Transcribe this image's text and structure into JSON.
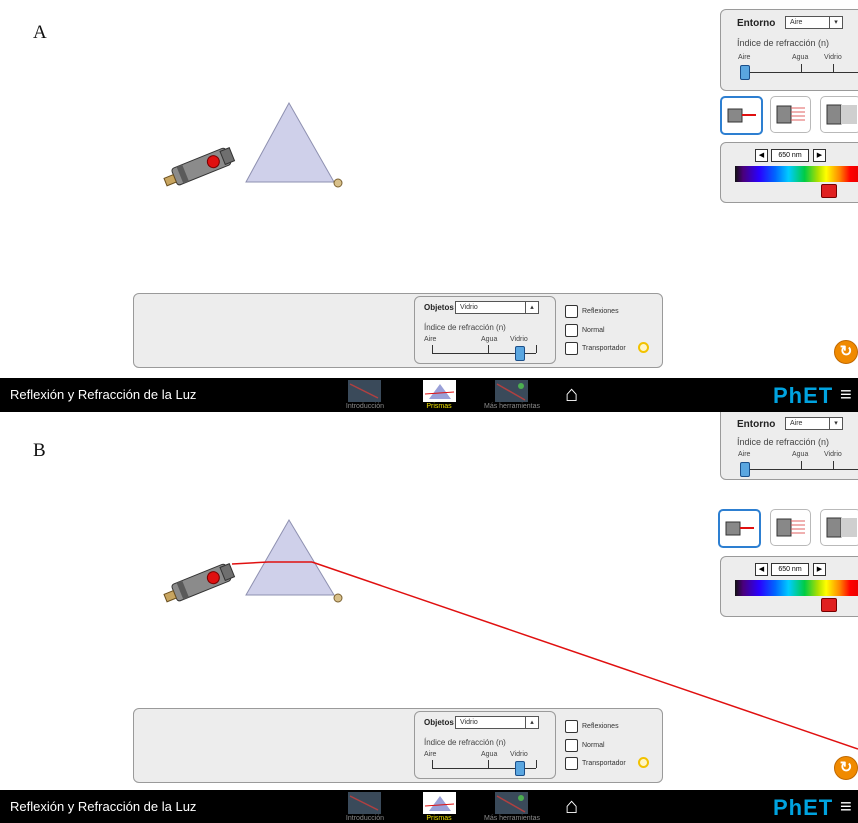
{
  "panels": [
    {
      "letter": "A",
      "environment": {
        "label": "Entorno",
        "selected": "Aire",
        "refraction_label": "Índice de refracción (n)",
        "ticks": [
          "Aire",
          "Agua",
          "Vidrio"
        ],
        "level": 0
      },
      "wavelength": {
        "value": "650 nm",
        "prev": "◀",
        "next": "▶"
      },
      "objects": {
        "label": "Objetos",
        "selected": "Vidrio",
        "refraction_label": "Índice de refracción (n)",
        "ticks": [
          "Aire",
          "Agua",
          "Vidrio"
        ],
        "level": 1
      },
      "checkboxes": [
        "Reflexiones",
        "Normal",
        "Transportador"
      ],
      "laser_on": false
    },
    {
      "letter": "B",
      "environment": {
        "label": "Entorno",
        "selected": "Aire",
        "refraction_label": "Índice de refracción (n)",
        "ticks": [
          "Aire",
          "Agua",
          "Vidrio"
        ],
        "level": 0
      },
      "wavelength": {
        "value": "650 nm",
        "prev": "◀",
        "next": "▶"
      },
      "objects": {
        "label": "Objetos",
        "selected": "Vidrio",
        "refraction_label": "Índice de refracción (n)",
        "ticks": [
          "Aire",
          "Agua",
          "Vidrio"
        ],
        "level": 1
      },
      "checkboxes": [
        "Reflexiones",
        "Normal",
        "Transportador"
      ],
      "laser_on": true
    }
  ],
  "navbar": {
    "title": "Reflexión y Refracción de la Luz",
    "tabs": [
      "Introducción",
      "Prismas",
      "Más herramientas"
    ],
    "active_tab": "Prismas",
    "brand": "PhET",
    "home_icon": "home-icon",
    "menu_icon": "hamburger-menu-icon"
  },
  "colors": {
    "beam": "#e01010",
    "prism": "#cfd0ea",
    "accent": "#2d7fd1",
    "reset": "#f08a00"
  }
}
